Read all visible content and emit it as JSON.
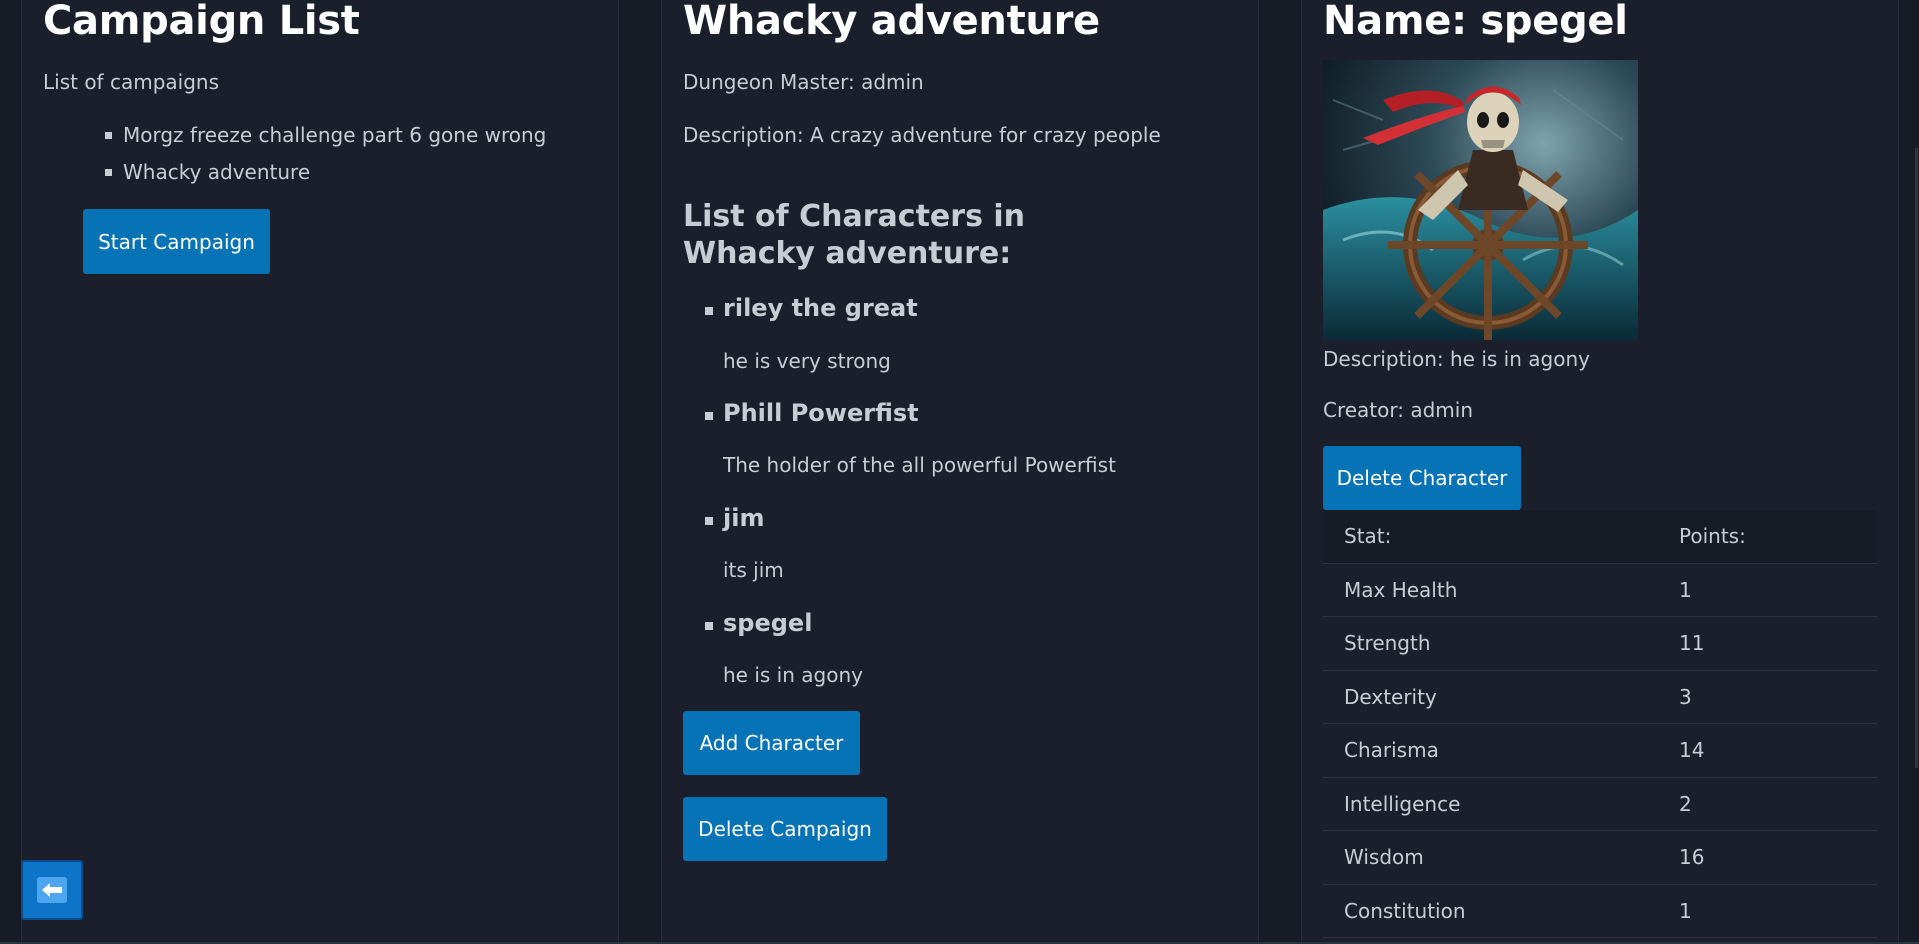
{
  "campaign_list": {
    "title": "Campaign List",
    "subtitle": "List of campaigns",
    "campaigns": [
      "Morgz freeze challenge part 6 gone wrong",
      "Whacky adventure"
    ],
    "start_button": "Start Campaign"
  },
  "campaign": {
    "title": "Whacky adventure",
    "dungeon_master": "Dungeon Master: admin",
    "description": "Description: A crazy adventure for crazy people",
    "characters_heading": "List of Characters in Whacky adventure:",
    "characters": [
      {
        "name": "riley the great",
        "description": "he is very strong"
      },
      {
        "name": "Phill Powerfist",
        "description": "The holder of the all powerful Powerfist"
      },
      {
        "name": "jim",
        "description": "its jim"
      },
      {
        "name": "spegel",
        "description": "he is in agony"
      }
    ],
    "add_button": "Add Character",
    "delete_button": "Delete Campaign"
  },
  "character": {
    "name": "Name: spegel",
    "portrait_icon": "pirate-skeleton-portrait",
    "description": "Description: he is in agony",
    "creator": "Creator: admin",
    "delete_button": "Delete Character",
    "stats_headers": [
      "Stat:",
      "Points:"
    ],
    "stats": [
      {
        "stat": "Max Health",
        "points": "1"
      },
      {
        "stat": "Strength",
        "points": "11"
      },
      {
        "stat": "Dexterity",
        "points": "3"
      },
      {
        "stat": "Charisma",
        "points": "14"
      },
      {
        "stat": "Intelligence",
        "points": "2"
      },
      {
        "stat": "Wisdom",
        "points": "16"
      },
      {
        "stat": "Constitution",
        "points": "1"
      }
    ]
  },
  "back_button": {
    "icon": "back-arrow-icon"
  },
  "colors": {
    "background": "#161b26",
    "panel": "#1a1f2b",
    "accent": "#0673b7",
    "heading": "#ffffff",
    "text": "#c8ccd4"
  }
}
